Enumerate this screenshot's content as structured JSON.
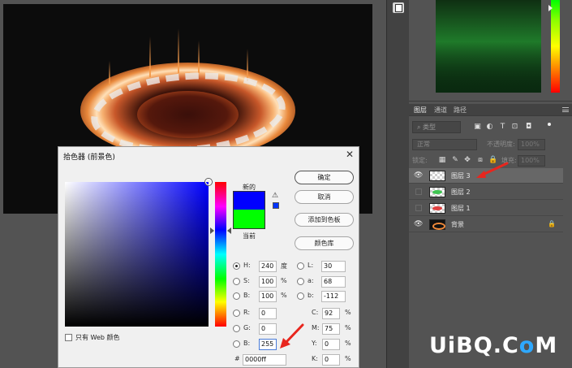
{
  "canvas": {
    "colors": {
      "background": "#0c0c0c",
      "fire": "#f49a4a"
    }
  },
  "color_panel": {
    "colors": {
      "field": "#1f7a2a",
      "hue_top": "#00ff00",
      "hue_bottom": "#ff0000"
    }
  },
  "layers_panel": {
    "tabs": [
      {
        "label": "图层",
        "active": true
      },
      {
        "label": "通道",
        "active": false
      },
      {
        "label": "路径",
        "active": false
      }
    ],
    "filter_label": "类型",
    "filter_icons": [
      "image-filter-icon",
      "adjustment-filter-icon",
      "type-filter-icon",
      "shape-filter-icon",
      "smart-object-filter-icon"
    ],
    "blend_mode": "正常",
    "opacity_label": "不透明度:",
    "opacity_value": "100%",
    "lock_label": "锁定:",
    "fill_label": "填充:",
    "fill_value": "100%",
    "layers": [
      {
        "name": "图层 3",
        "visible": true,
        "selected": true,
        "thumb": "transparent"
      },
      {
        "name": "图层 2",
        "visible": false,
        "selected": false,
        "thumb": "green"
      },
      {
        "name": "图层 1",
        "visible": false,
        "selected": false,
        "thumb": "red"
      },
      {
        "name": "背景",
        "visible": true,
        "selected": false,
        "thumb": "fire",
        "locked": true
      }
    ]
  },
  "color_picker": {
    "title": "拾色器 (前景色)",
    "new_label": "新的",
    "current_label": "当前",
    "new_color": "#0000ff",
    "current_color": "#00ff00",
    "buttons": {
      "ok": "确定",
      "cancel": "取消",
      "add_swatch": "添加到色板",
      "libraries": "颜色库"
    },
    "web_only_label": "只有 Web 颜色",
    "fields": {
      "H": {
        "label": "H:",
        "value": "240",
        "unit": "度"
      },
      "S": {
        "label": "S:",
        "value": "100",
        "unit": "%"
      },
      "Bright": {
        "label": "B:",
        "value": "100",
        "unit": "%"
      },
      "R": {
        "label": "R:",
        "value": "0"
      },
      "G": {
        "label": "G:",
        "value": "0"
      },
      "Blue": {
        "label": "B:",
        "value": "255"
      },
      "L": {
        "label": "L:",
        "value": "30"
      },
      "a": {
        "label": "a:",
        "value": "68"
      },
      "b": {
        "label": "b:",
        "value": "-112"
      },
      "C": {
        "label": "C:",
        "value": "92",
        "unit": "%"
      },
      "M": {
        "label": "M:",
        "value": "75",
        "unit": "%"
      },
      "Y": {
        "label": "Y:",
        "value": "0",
        "unit": "%"
      },
      "K": {
        "label": "K:",
        "value": "0",
        "unit": "%"
      },
      "hex_label": "#",
      "hex": "0000ff"
    }
  },
  "watermark": {
    "text_main": "UiBQ.C",
    "text_accent": "o",
    "text_end": "M"
  }
}
